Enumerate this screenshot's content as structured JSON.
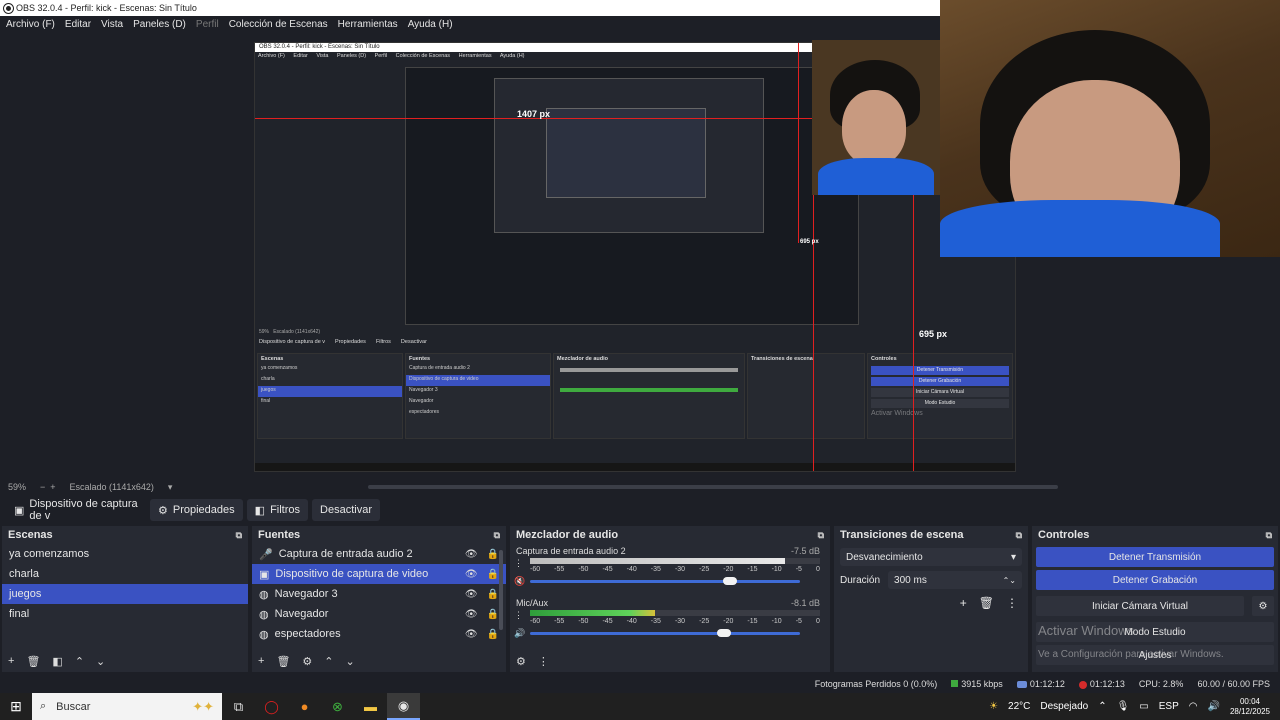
{
  "window": {
    "title": "OBS 32.0.4 - Perfil: kick - Escenas: Sin Título"
  },
  "menu": [
    "Archivo (F)",
    "Editar",
    "Vista",
    "Paneles (D)",
    "Perfil",
    "Colección de Escenas",
    "Herramientas",
    "Ayuda (H)"
  ],
  "preview": {
    "measure_1": "1407 px",
    "measure_2": "695 px",
    "measure_3": "695 px",
    "nested_title": "OBS 32.0.4 - Perfil: kick - Escenas: Sin Título",
    "nested_menu": [
      "Archivo (F)",
      "Editar",
      "Vista",
      "Paneles (D)",
      "Perfil",
      "Colección de Escenas",
      "Herramientas",
      "Ayuda (H)"
    ],
    "nested_zoom": "59%",
    "nested_scaled": "Escalado (1141x642)",
    "nested_source": "Dispositivo de captura de v",
    "nested_props": "Propiedades",
    "nested_filters": "Filtros",
    "nested_deactivate": "Desactivar",
    "nested_scenes_title": "Escenas",
    "nested_sources_title": "Fuentes",
    "nested_mixer_title": "Mezclador de audio",
    "nested_trans_title": "Transiciones de escena",
    "nested_controls_title": "Controles",
    "nested_scenes": [
      "ya comenzamos",
      "charla",
      "juegos",
      "final"
    ],
    "nested_sources": [
      "Captura de entrada audio 2",
      "Dispositivo de captura de video",
      "Navegador 3",
      "Navegador",
      "espectadores"
    ],
    "nested_stop_stream": "Detener Transmisión",
    "nested_stop_rec": "Detener Grabación",
    "nested_virtualcam": "Iniciar Cámara Virtual",
    "nested_studio": "Modo Estudio",
    "nested_activate": "Activar Windows"
  },
  "zoom_row": {
    "zoom": "59%",
    "scaled": "Escalado (1141x642)"
  },
  "source_toolbar": {
    "source_name": "Dispositivo de captura de v",
    "properties": "Propiedades",
    "filters": "Filtros",
    "deactivate": "Desactivar"
  },
  "scenes": {
    "title": "Escenas",
    "items": [
      "ya comenzamos",
      "charla",
      "juegos",
      "final"
    ],
    "selected": "juegos"
  },
  "sources": {
    "title": "Fuentes",
    "items": [
      "Captura de entrada audio 2",
      "Dispositivo de captura de video",
      "Navegador 3",
      "Navegador",
      "espectadores"
    ],
    "selected": "Dispositivo de captura de video"
  },
  "mixer": {
    "title": "Mezclador de audio",
    "channels": [
      {
        "name": "Captura de entrada audio 2",
        "db": "-7.5 dB",
        "volume": 0.74,
        "level": 0.88
      },
      {
        "name": "Mic/Aux",
        "db": "-8.1 dB",
        "volume": 0.72,
        "level": 0.43
      }
    ],
    "scale": [
      "-60",
      "-55",
      "-50",
      "-45",
      "-40",
      "-35",
      "-30",
      "-25",
      "-20",
      "-15",
      "-10",
      "-5",
      "0"
    ]
  },
  "transitions": {
    "title": "Transiciones de escena",
    "selected": "Desvanecimiento",
    "duration_label": "Duración",
    "duration_value": "300 ms"
  },
  "controls": {
    "title": "Controles",
    "stop_stream": "Detener Transmisión",
    "stop_recording": "Detener Grabación",
    "virtual_cam": "Iniciar Cámara Virtual",
    "studio_mode": "Modo Estudio",
    "settings": "Ajustes",
    "activate_windows_1": "Activar Windows",
    "activate_windows_2": "Ve a Configuración para activar Windows."
  },
  "status": {
    "dropped": "Fotogramas Perdidos 0 (0.0%)",
    "bitrate": "3915 kbps",
    "live_time": "01:12:12",
    "rec_time": "01:12:13",
    "cpu": "CPU: 2.8%",
    "fps": "60.00 / 60.00 FPS"
  },
  "taskbar": {
    "search_placeholder": "Buscar",
    "weather": "22°C",
    "weather_desc": "Despejado",
    "lang": "ESP",
    "time": "00:04",
    "date": "28/12/2025"
  },
  "colors": {
    "accent": "#3a52c2",
    "background": "#1d1f26",
    "dock": "#272a33",
    "record": "#d42b2b"
  }
}
